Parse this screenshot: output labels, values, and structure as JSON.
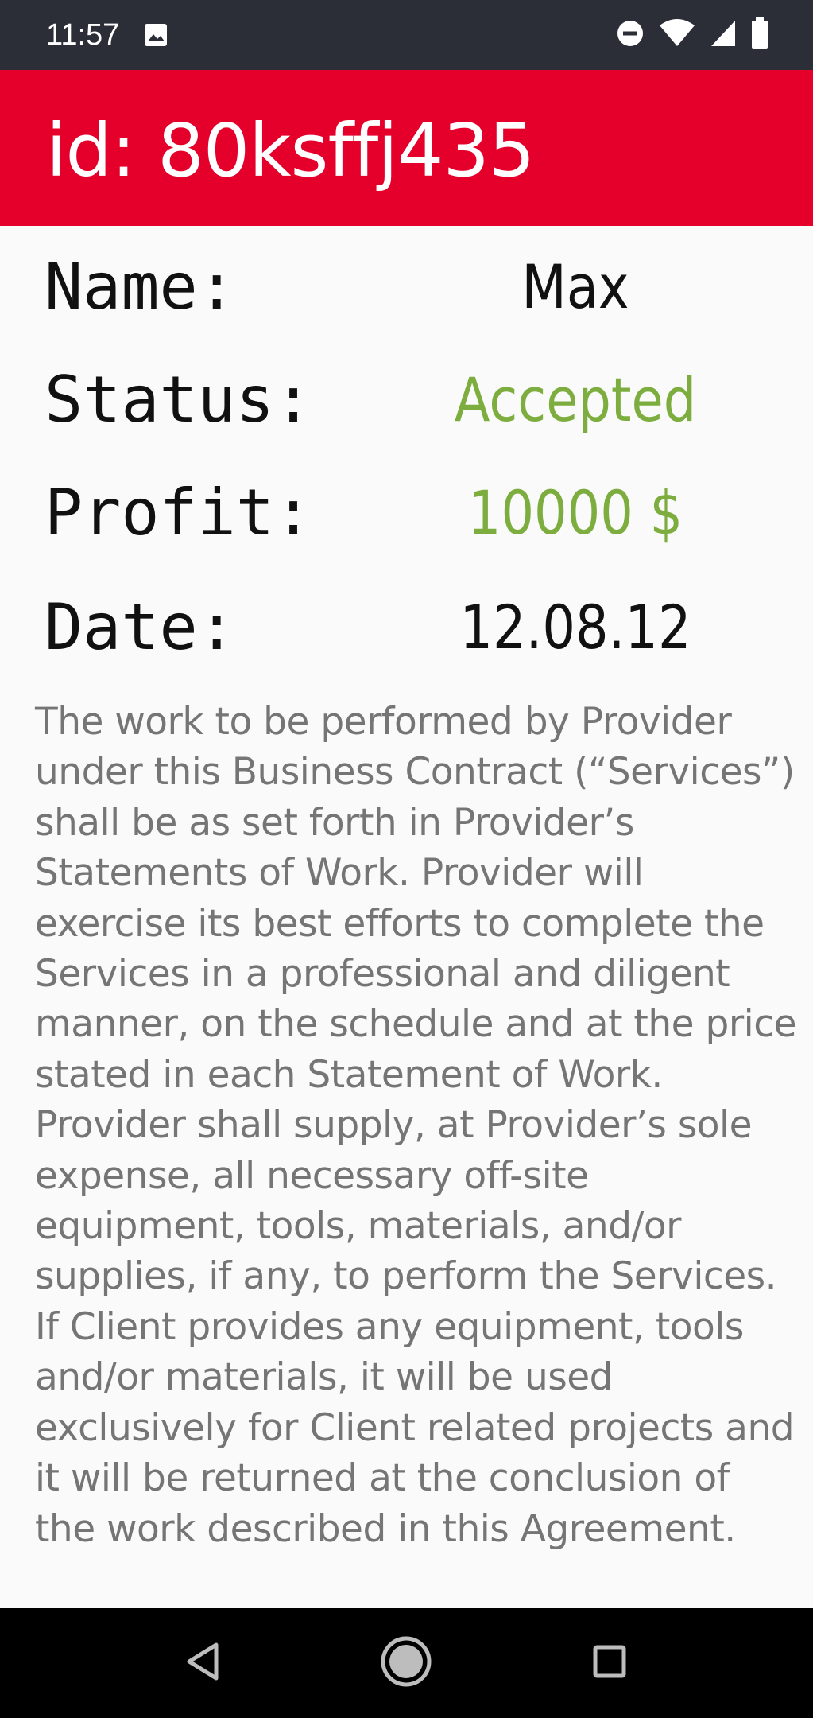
{
  "status_bar": {
    "time": "11:57",
    "icons": [
      "image-icon",
      "do-not-disturb-icon",
      "wifi-icon",
      "signal-icon",
      "battery-icon"
    ]
  },
  "header": {
    "title": "id: 80ksffj435",
    "background_color": "#e4002b"
  },
  "details": {
    "name": {
      "label": "Name:",
      "value": "Max",
      "color": "#111111"
    },
    "status": {
      "label": "Status:",
      "value": "Accepted",
      "color": "#7cad3e"
    },
    "profit": {
      "label": "Profit:",
      "value": "10000 $",
      "color": "#7cad3e"
    },
    "date": {
      "label": "Date:",
      "value": "12.08.12",
      "color": "#111111"
    }
  },
  "description": "The work to be performed by Provider under this Business Contract (“Services”) shall be as set forth in Provider’s Statements of Work. Provider will exercise its best efforts to complete the Services in a professional and diligent manner, on the schedule and at the price stated in each Statement of Work. Provider shall supply, at Provider’s sole expense, all necessary off-site equipment, tools, materials, and/or supplies, if any, to perform the Services. If Client provides any equipment, tools and/or materials, it will be used exclusively for Client related projects and it will be returned at the conclusion of the work described in this Agreement.",
  "nav_bar": {
    "icons": [
      "back-icon",
      "home-icon",
      "recents-icon"
    ]
  }
}
